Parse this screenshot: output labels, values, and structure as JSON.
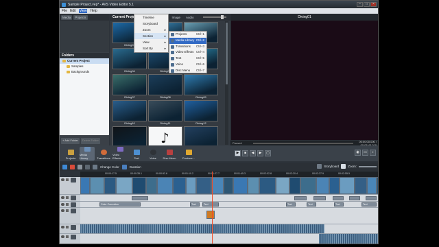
{
  "window": {
    "title": "Sample Project.vep* - AVS Video Editor 5.1",
    "minimize": "–",
    "maximize": "□",
    "close": "×"
  },
  "menubar": [
    "File",
    "Edit",
    "View",
    "Help"
  ],
  "left": {
    "media_tabs": [
      "Media",
      "Projects"
    ],
    "folders_title": "Folders",
    "folders": [
      "Current Project",
      "Samples",
      "Backgrounds"
    ],
    "add_folder": "+ Add Folder",
    "delete_folder": "Delete Folder"
  },
  "library": {
    "title": "Current Project",
    "filters": [
      "All",
      "Video",
      "Image",
      "Audio"
    ],
    "items": [
      "Diving01",
      "Diving02",
      "Diving03",
      "Diving04",
      "Diving05",
      "Diving06",
      "Diving07",
      "Diving08",
      "Diving09",
      "Diving10",
      "Diving11",
      "Diving12",
      "",
      "",
      ""
    ]
  },
  "view_menu": {
    "items": [
      "Timeline",
      "Storyboard",
      "Zoom",
      "Section",
      "View",
      "Sort By"
    ]
  },
  "section_menu": {
    "items": [
      {
        "label": "Projects",
        "shortcut": "Ctrl+1"
      },
      {
        "label": "Media Library",
        "shortcut": "Ctrl+2"
      },
      {
        "label": "Transitions",
        "shortcut": "Ctrl+3"
      },
      {
        "label": "Video Effects",
        "shortcut": "Ctrl+4"
      },
      {
        "label": "Text",
        "shortcut": "Ctrl+5"
      },
      {
        "label": "Voice",
        "shortcut": "Ctrl+6"
      },
      {
        "label": "Disc Menu",
        "shortcut": "Ctrl+7"
      }
    ]
  },
  "preview": {
    "title": "Diving01",
    "status_label": "Paused",
    "timecode": "00:00:00.000 / 00:08:45.019"
  },
  "toolbar": [
    "Projects",
    "Media Library",
    "Transitions",
    "Video Effects",
    "Text",
    "Voice",
    "Disc Menu",
    "Produce..."
  ],
  "timeline_toolbar": {
    "change_color": "Change Color",
    "duration": "Duration",
    "storyboard": "Storyboard",
    "zoom": "Zoom:"
  },
  "ruler": [
    "00:00:17.5",
    "00:00:35.1",
    "00:00:52.6",
    "00:01:10.2",
    "00:01:27.7",
    "00:01:45.3",
    "00:02:02.8",
    "00:02:20.4",
    "00:02:37.9",
    "00:02:55.5"
  ],
  "text_clips": [
    "Color Correction",
    "Text",
    "Text",
    "Text",
    "Text",
    "Text",
    "Text"
  ],
  "colors": {
    "accent": "#316ac5",
    "bg": "#2d333a",
    "playhead": "#f04a24"
  }
}
